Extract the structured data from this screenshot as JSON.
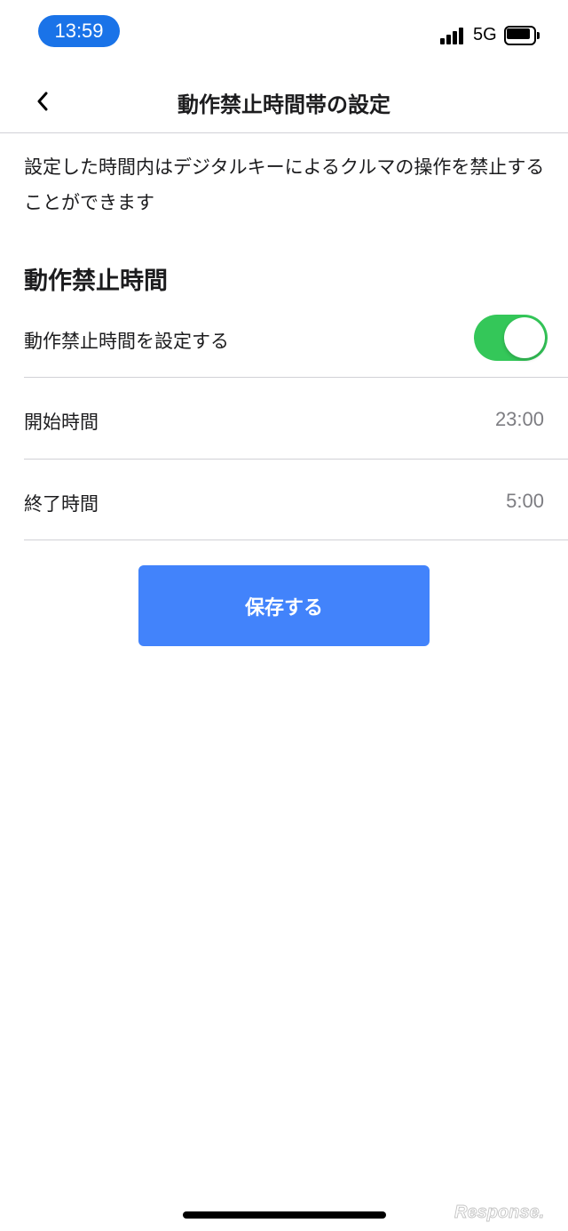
{
  "status_bar": {
    "time": "13:59",
    "network": "5G",
    "icons": [
      "signal-icon",
      "battery-icon"
    ]
  },
  "nav": {
    "title": "動作禁止時間帯の設定",
    "back_icon": "chevron-left-icon"
  },
  "description": "設定した時間内はデジタルキーによるクルマの操作を禁止することができます",
  "section": {
    "title": "動作禁止時間",
    "toggle_row": {
      "label": "動作禁止時間を設定する",
      "enabled": true
    },
    "start_row": {
      "label": "開始時間",
      "value": "23:00"
    },
    "end_row": {
      "label": "終了時間",
      "value": "5:00"
    }
  },
  "save_button": {
    "label": "保存する"
  },
  "watermark": "Response.",
  "colors": {
    "accent": "#4283fb",
    "toggle_on": "#34c759",
    "time_pill": "#1a73e8",
    "divider": "#d1d1d6",
    "value_text": "#7d7d82"
  }
}
